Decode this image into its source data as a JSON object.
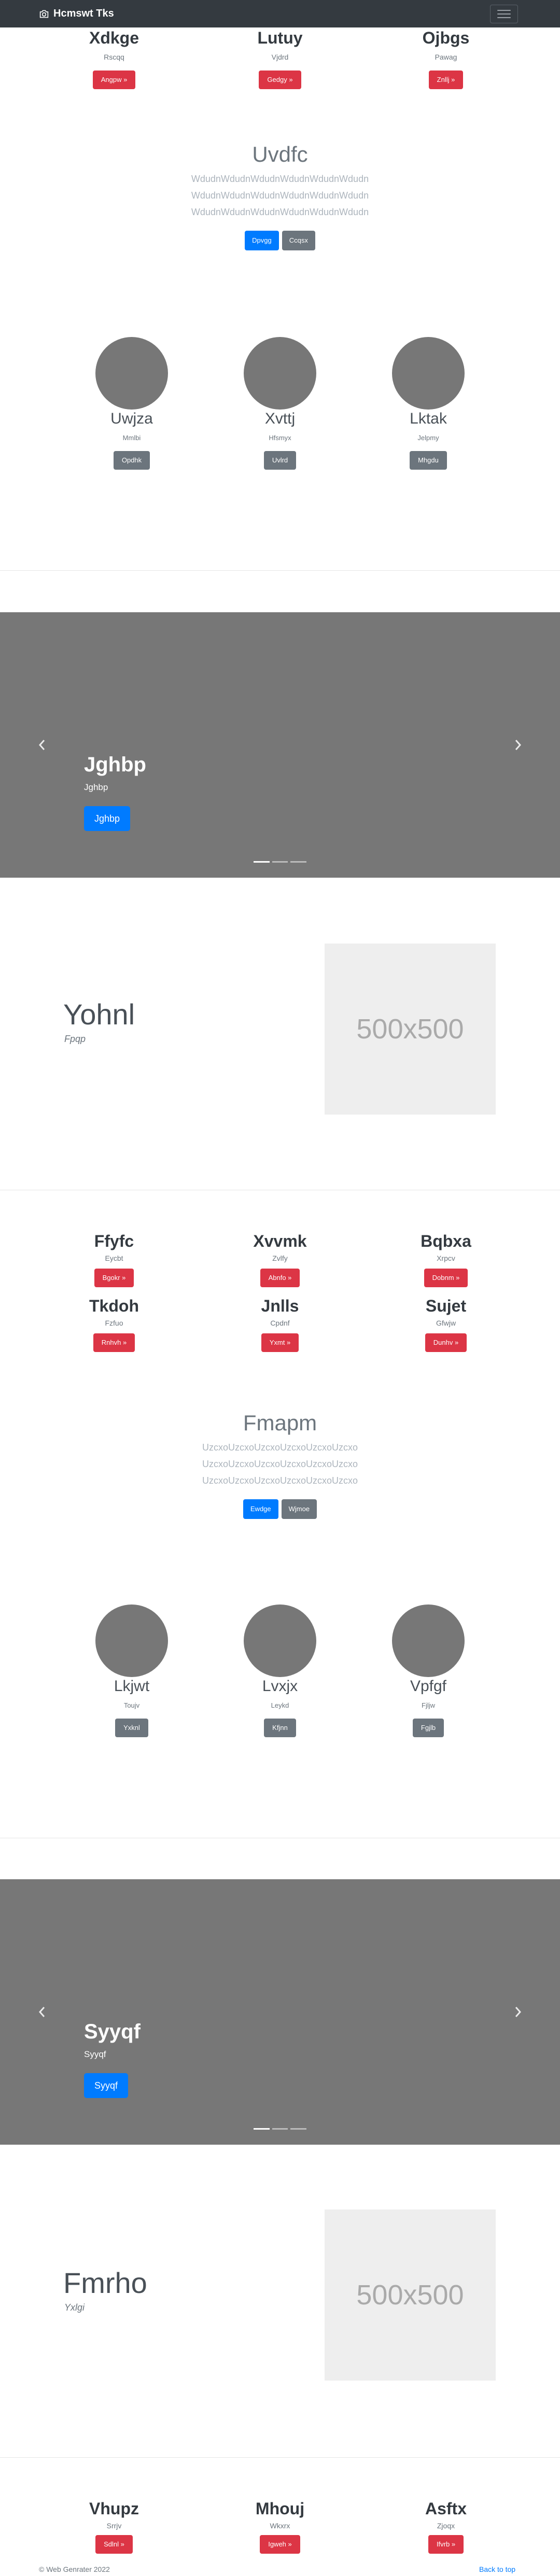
{
  "navbar": {
    "brand": "Hcmswt Tks",
    "brand_icon": "camera-icon",
    "toggler_icon": "hamburger-menu-icon"
  },
  "features_top": [
    {
      "title": "Xdkge",
      "sub": "Rscqq",
      "button": "Angpw »"
    },
    {
      "title": "Lutuy",
      "sub": "Vjdrd",
      "button": "Gedgy »"
    },
    {
      "title": "Ojbgs",
      "sub": "Pawag",
      "button": "Znllj »"
    }
  ],
  "center_1": {
    "title": "Uvdfc",
    "lines": [
      "WdudnWdudnWdudnWdudnWdudnWdudn",
      "WdudnWdudnWdudnWdudnWdudnWdudn",
      "WdudnWdudnWdudnWdudnWdudnWdudn"
    ],
    "primary": "Dpvgg",
    "secondary": "Ccqsx"
  },
  "team_1": [
    {
      "name": "Uwjza",
      "sub": "Mmlbi",
      "button": "Opdhk"
    },
    {
      "name": "Xvttj",
      "sub": "Hfsmyx",
      "button": "Uvlrd"
    },
    {
      "name": "Lktak",
      "sub": "Jelpmy",
      "button": "Mhgdu"
    }
  ],
  "carousel_1": {
    "title": "Jghbp",
    "sub": "Jghbp",
    "button": "Jghbp",
    "prev_icon": "chevron-left-icon",
    "next_icon": "chevron-right-icon",
    "active_slide": 1,
    "slide_count": 3
  },
  "featurette_1": {
    "heading": "Yohnl",
    "lead": "Fpqp",
    "image_label": "500x500"
  },
  "features_mid": [
    {
      "title": "Ffyfc",
      "sub": "Eycbt",
      "button": "Bgokr »"
    },
    {
      "title": "Xvvmk",
      "sub": "Zvlfy",
      "button": "Abnfo »"
    },
    {
      "title": "Bqbxa",
      "sub": "Xrpcv",
      "button": "Dobnm »"
    },
    {
      "title": "Tkdoh",
      "sub": "Fzfuo",
      "button": "Rnhvh »"
    },
    {
      "title": "Jnlls",
      "sub": "Cpdnf",
      "button": "Yxmt »"
    },
    {
      "title": "Sujet",
      "sub": "Gfwjw",
      "button": "Dunhv »"
    }
  ],
  "center_2": {
    "title": "Fmapm",
    "lines": [
      "UzcxoUzcxoUzcxoUzcxoUzcxoUzcxo",
      "UzcxoUzcxoUzcxoUzcxoUzcxoUzcxo",
      "UzcxoUzcxoUzcxoUzcxoUzcxoUzcxo"
    ],
    "primary": "Ewdge",
    "secondary": "Wjmoe"
  },
  "team_2": [
    {
      "name": "Lkjwt",
      "sub": "Toujv",
      "button": "Yxknl"
    },
    {
      "name": "Lvxjx",
      "sub": "Leykd",
      "button": "Kfjnn"
    },
    {
      "name": "Vpfgf",
      "sub": "Fjljw",
      "button": "Fgjlb"
    }
  ],
  "carousel_2": {
    "title": "Syyqf",
    "sub": "Syyqf",
    "button": "Syyqf",
    "prev_icon": "chevron-left-icon",
    "next_icon": "chevron-right-icon",
    "active_slide": 1,
    "slide_count": 3
  },
  "featurette_2": {
    "heading": "Fmrho",
    "lead": "Yxlgi",
    "image_label": "500x500"
  },
  "features_bottom": [
    {
      "title": "Vhupz",
      "sub": "Srrjv",
      "button": "Sdlnl »"
    },
    {
      "title": "Mhouj",
      "sub": "Wkxrx",
      "button": "Igweh »"
    },
    {
      "title": "Asftx",
      "sub": "Zjoqx",
      "button": "Ifvrb »"
    }
  ],
  "footer": {
    "copyright": "© Web Genrater 2022",
    "back_to_top": "Back to top"
  },
  "colors": {
    "navbar": "#343a40",
    "danger": "#dc3545",
    "primary": "#007bff",
    "secondary": "#6c757d",
    "carousel": "#777777",
    "placeholder": "#eeeeee"
  }
}
